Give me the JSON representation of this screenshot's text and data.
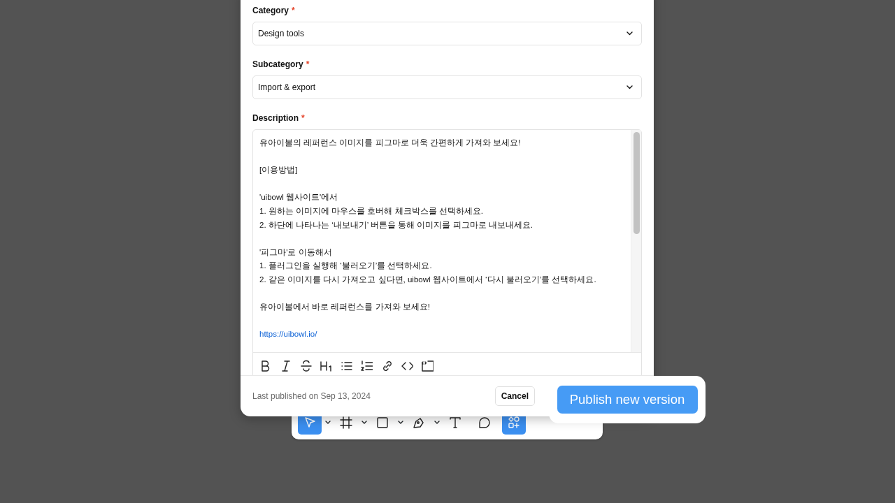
{
  "fields": [
    {
      "label": "Category",
      "required_mark": "*",
      "value": "Design tools"
    },
    {
      "label": "Subcategory",
      "required_mark": "*",
      "value": "Import & export"
    }
  ],
  "description": {
    "label": "Description",
    "required_mark": "*",
    "blocks": [
      {
        "kind": "text",
        "lines": [
          "유아이볼의 레퍼런스 이미지를 피그마로 더욱 간편하게 가져와 보세요!"
        ]
      },
      {
        "kind": "text",
        "lines": [
          "[이용방법]"
        ]
      },
      {
        "kind": "text",
        "lines": [
          "'uibowl 웹사이트'에서",
          "1. 원하는 이미지에 마우스를 호버해 체크박스를 선택하세요.",
          "2. 하단에 나타나는 ‘내보내기’ 버튼을 통해 이미지를 피그마로 내보내세요."
        ]
      },
      {
        "kind": "text",
        "lines": [
          "'피그마'로 이동해서",
          "1. 플러그인을 실행해 ‘불러오기’를 선택하세요.",
          "2. 같은 이미지를 다시 가져오고 싶다면, uibowl 웹사이트에서 ‘다시 불러오기’를 선택하세요."
        ]
      },
      {
        "kind": "text",
        "lines": [
          "유아이볼에서 바로 레퍼런스를 가져와 보세요!"
        ]
      },
      {
        "kind": "link",
        "lines": [
          "https://uibowl.io/"
        ]
      }
    ],
    "toolbar": [
      {
        "kind": "bold"
      },
      {
        "kind": "italic"
      },
      {
        "kind": "strike"
      },
      {
        "kind": "heading"
      },
      {
        "kind": "bullets"
      },
      {
        "kind": "numbered"
      },
      {
        "kind": "link"
      },
      {
        "kind": "code"
      },
      {
        "kind": "codeblock"
      }
    ]
  },
  "footer": {
    "note": "Last published on Sep 13, 2024",
    "cancel": "Cancel",
    "publish": "Publish new version"
  },
  "canvas_toolbar": [
    {
      "kind": "move",
      "selected": true,
      "menu": true
    },
    {
      "kind": "frame",
      "selected": false,
      "menu": true
    },
    {
      "kind": "shape",
      "selected": false,
      "menu": true
    },
    {
      "kind": "pen",
      "selected": false,
      "menu": true
    },
    {
      "kind": "text",
      "selected": false,
      "menu": false
    },
    {
      "kind": "comment",
      "selected": false,
      "menu": false
    },
    {
      "kind": "actions",
      "selected": true,
      "menu": false
    }
  ]
}
